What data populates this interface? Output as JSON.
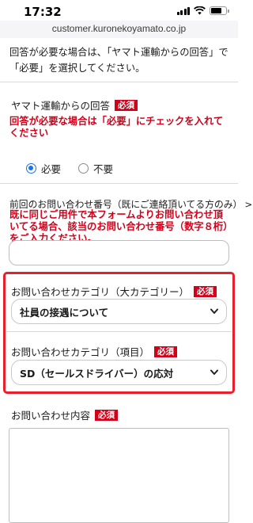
{
  "status_bar": {
    "time": "17:32"
  },
  "browser": {
    "url": "customer.kuronekoyamato.co.jp"
  },
  "form": {
    "intro": "回答が必要な場合は、「ヤマト運輸からの回答」で「必要」を選択してください。",
    "required_badge": "必須",
    "reply": {
      "label": "ヤマト運輸からの回答",
      "note": "回答が必要な場合は「必要」にチェックを入れてください",
      "options": [
        "必要",
        "不要"
      ],
      "selected": "必要"
    },
    "previous_inquiry": {
      "label": "前回のお問い合わせ番号（既にご連絡頂いてる方のみ）",
      "note": "既に同じご用件で本フォームよりお問い合わせ頂いてる場合、該当のお問い合わせ番号（数字８桁）をご入力ください。",
      "value": ""
    },
    "category_major": {
      "label": "お問い合わせカテゴリ（大カテゴリー）",
      "selected": "社員の接遇について"
    },
    "category_item": {
      "label": "お問い合わせカテゴリ（項目）",
      "selected": "SD（セールスドライバー）の応対"
    },
    "content": {
      "label": "お問い合わせ内容",
      "value": ""
    }
  },
  "colors": {
    "required": "#d4001a",
    "highlight_frame": "#e8202c",
    "radio_accent": "#1a73e8"
  }
}
